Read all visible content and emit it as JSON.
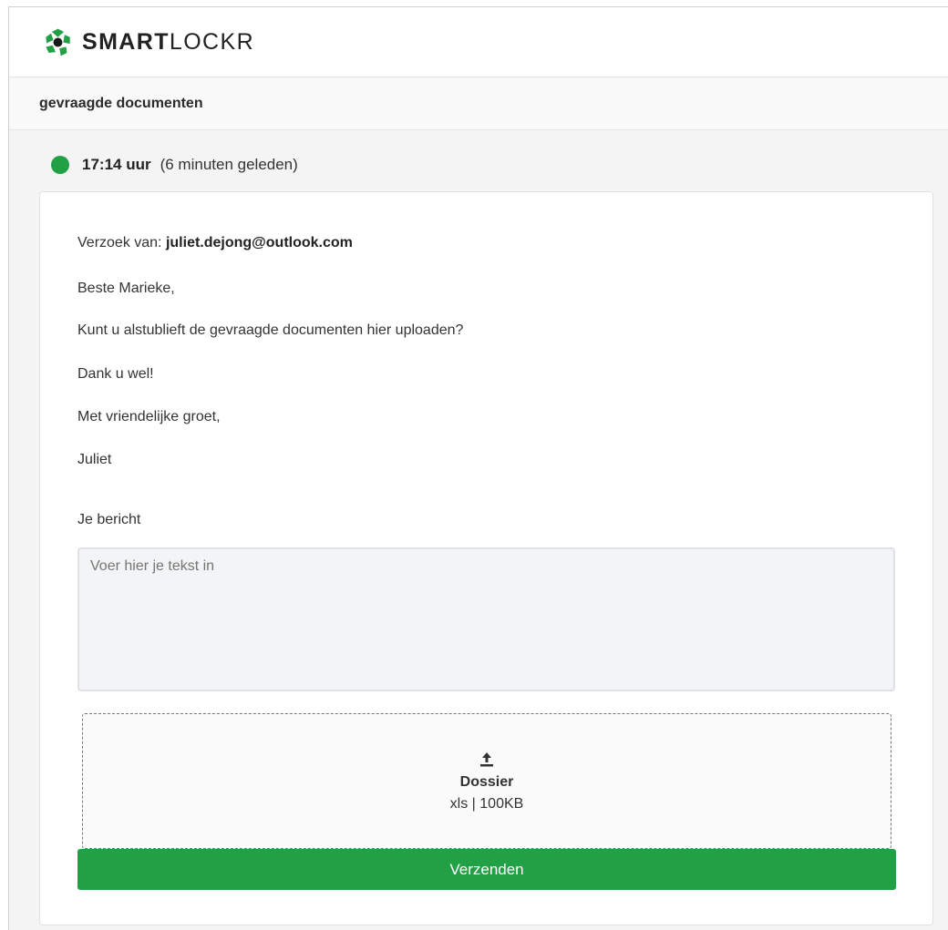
{
  "brand": {
    "name_bold": "SMART",
    "name_light": "LOCKR",
    "logo_icon": "smartlockr-logo-icon",
    "accent_color": "#22a046"
  },
  "subheader": {
    "title": "gevraagde documenten"
  },
  "status": {
    "time": "17:14 uur",
    "relative": "(6 minuten geleden)",
    "dot_color": "#22a046"
  },
  "message": {
    "from_label": "Verzoek van: ",
    "from_email": "juliet.dejong@outlook.com",
    "lines": [
      "Beste Marieke,",
      "Kunt u alstublieft de gevraagde documenten hier uploaden?",
      "Dank u wel!",
      "Met vriendelijke groet,",
      "Juliet"
    ]
  },
  "reply": {
    "label": "Je bericht",
    "placeholder": "Voer hier je tekst in",
    "value": ""
  },
  "upload": {
    "icon": "upload-icon",
    "title": "Dossier",
    "meta": "xls | 100KB"
  },
  "actions": {
    "send_label": "Verzenden"
  }
}
